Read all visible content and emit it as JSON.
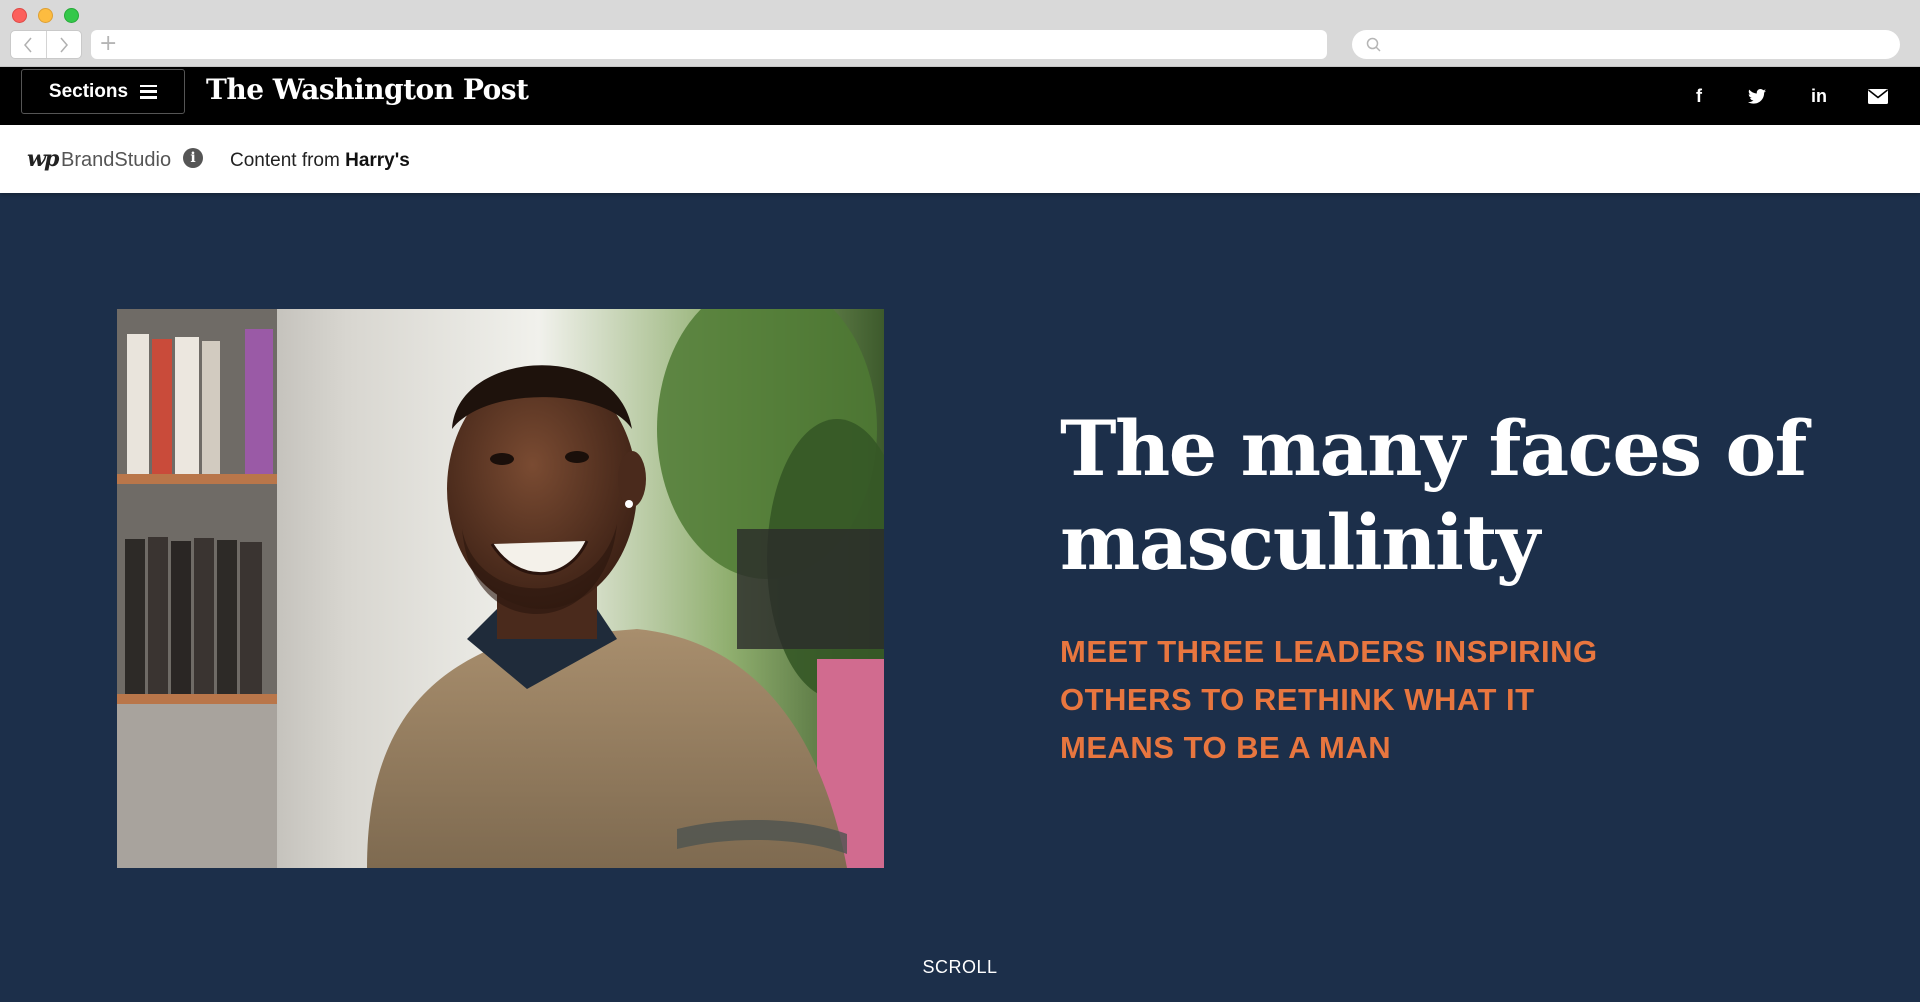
{
  "header": {
    "sections_label": "Sections",
    "logo": "The Washington Post",
    "social": {
      "facebook": "f",
      "linkedin": "in"
    }
  },
  "brandbar": {
    "wp_mark": "wp",
    "brand_studio": "BrandStudio",
    "content_from_prefix": "Content from",
    "sponsor": "Harry's"
  },
  "hero": {
    "headline": "The many faces of masculinity",
    "subhead": "MEET THREE LEADERS INSPIRING OTHERS TO RETHINK WHAT IT MEANS TO BE A MAN",
    "scroll": "SCROLL"
  },
  "colors": {
    "hero_background": "#1c2f4a",
    "accent": "#e8763f",
    "header_background": "#000000"
  },
  "icons": [
    "back-arrow-icon",
    "forward-arrow-icon",
    "new-tab-plus-icon",
    "search-icon",
    "hamburger-menu-icon",
    "facebook-icon",
    "twitter-icon",
    "linkedin-icon",
    "email-icon",
    "info-icon"
  ]
}
